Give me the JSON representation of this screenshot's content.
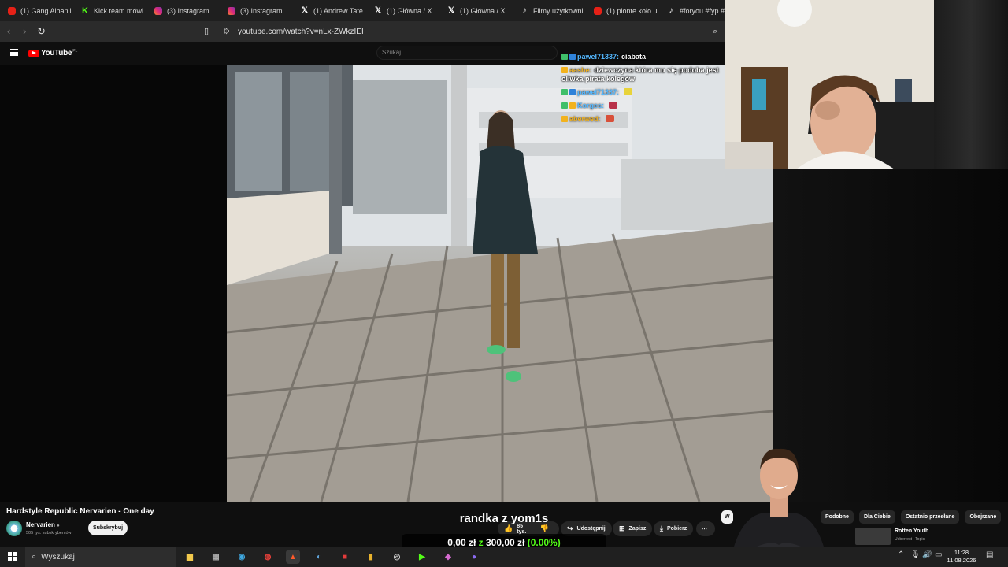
{
  "browser": {
    "tabs": [
      {
        "label": "(1) Gang Albanii",
        "icon": "youtube-icon"
      },
      {
        "label": "Kick team mówi",
        "icon": "kick-icon"
      },
      {
        "label": "(3) Instagram",
        "icon": "instagram-icon"
      },
      {
        "label": "(3) Instagram",
        "icon": "instagram-icon"
      },
      {
        "label": "(1) Andrew Tate",
        "icon": "x-icon"
      },
      {
        "label": "(1) Główna / X",
        "icon": "x-icon"
      },
      {
        "label": "(1) Główna / X",
        "icon": "x-icon"
      },
      {
        "label": "Filmy użytkowni",
        "icon": "tiktok-icon"
      },
      {
        "label": "(1) pionte koło u",
        "icon": "youtube-icon"
      },
      {
        "label": "#foryou #fyp #",
        "icon": "tiktok-icon"
      }
    ],
    "url": "youtube.com/watch?v=nLx-ZWkzIEI"
  },
  "youtube": {
    "logo_text": "YouTube",
    "logo_region": "PL",
    "search_placeholder": "Szukaj"
  },
  "chat": [
    {
      "user": "pawel71337:",
      "message": "ciabata",
      "user_color": "#55b8ff",
      "emote": null
    },
    {
      "user": "aashe:",
      "message": "dziewczyna która mu się podoba jest",
      "user_color": "#f2b21d",
      "emote": null
    },
    {
      "user": "",
      "message": "oliwka pirata kolegów",
      "user_color": "#55b8ff",
      "emote": null
    },
    {
      "user": "pawel71337:",
      "message": "",
      "user_color": "#55b8ff",
      "emote": "#e8d33a"
    },
    {
      "user": "Korges:",
      "message": "",
      "user_color": "#55b8ff",
      "emote": "#b8324a"
    },
    {
      "user": "aberwed:",
      "message": "",
      "user_color": "#f2b21d",
      "emote": "#d8503a"
    }
  ],
  "video": {
    "title": "Hardstyle Republic Nervarien - One day",
    "channel": "Nervarien",
    "subscribers": "505 tys. subskrybentów",
    "subscribe_label": "Subskrybuj",
    "likes": "85 tys.",
    "share_label": "Udostępnij",
    "save_label": "Zapisz",
    "download_label": "Pobierz"
  },
  "stream_overlay": {
    "title": "randka z yom1s",
    "goal_current": "0,00 zł",
    "goal_sep": "z",
    "goal_target": "300,00 zł",
    "goal_percent": "(0.00%)"
  },
  "chips": [
    "W",
    "Podobne",
    "Dla Ciebie",
    "Ostatnio przesłane",
    "Obejrzane"
  ],
  "recommendation": {
    "title": "Rotten Youth",
    "subtitle": "Ueberrest - Topic"
  },
  "taskbar": {
    "search_label": "Wyszukaj",
    "time": "11:28",
    "date": "11.08.2026"
  },
  "colors": {
    "kick_green": "#53fc18",
    "youtube_red": "#ff0000"
  }
}
